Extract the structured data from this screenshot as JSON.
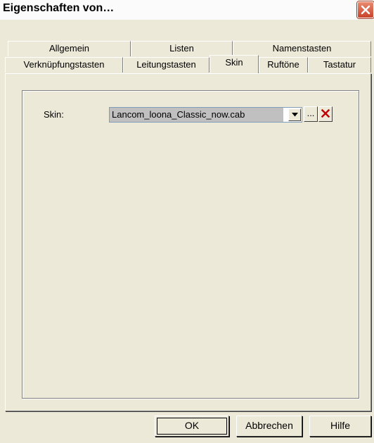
{
  "window": {
    "title": "Eigenschaften von…"
  },
  "tabs_row_back": [
    {
      "label": "Allgemein"
    },
    {
      "label": "Listen"
    },
    {
      "label": "Namenstasten"
    }
  ],
  "tabs_row_front": [
    {
      "label": "Verknüpfungstasten"
    },
    {
      "label": "Leitungstasten"
    },
    {
      "label": "Skin",
      "active": true
    },
    {
      "label": "Ruftöne"
    },
    {
      "label": "Tastatur"
    }
  ],
  "skin": {
    "label": "Skin:",
    "selected_value": "Lancom_loona_Classic_now.cab",
    "browse_label": "...",
    "dropdown_icon": "chevron-down-icon",
    "delete_icon": "delete-x-icon"
  },
  "buttons": {
    "ok": "OK",
    "cancel": "Abbrechen",
    "help": "Hilfe"
  },
  "colors": {
    "dialog_bg": "#ece9d8",
    "close_button": "#c8432a",
    "combo_selection": "#c0c0c0",
    "delete_icon": "#c00000"
  }
}
